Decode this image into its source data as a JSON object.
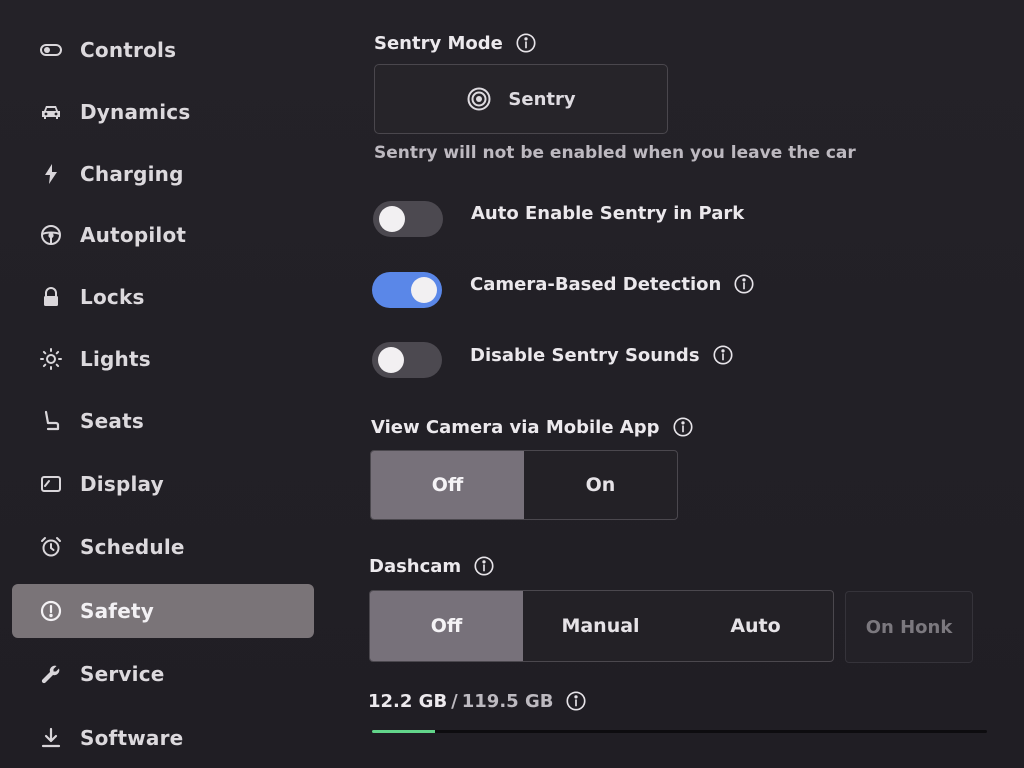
{
  "sidebar": {
    "items": [
      {
        "label": "Controls",
        "icon": "toggle-icon"
      },
      {
        "label": "Dynamics",
        "icon": "car-icon"
      },
      {
        "label": "Charging",
        "icon": "lightning-icon"
      },
      {
        "label": "Autopilot",
        "icon": "steering-wheel-icon"
      },
      {
        "label": "Locks",
        "icon": "lock-icon"
      },
      {
        "label": "Lights",
        "icon": "sun-icon"
      },
      {
        "label": "Seats",
        "icon": "seat-icon"
      },
      {
        "label": "Display",
        "icon": "display-icon"
      },
      {
        "label": "Schedule",
        "icon": "alarm-clock-icon"
      },
      {
        "label": "Safety",
        "icon": "alert-circle-icon"
      },
      {
        "label": "Service",
        "icon": "wrench-icon"
      },
      {
        "label": "Software",
        "icon": "download-icon"
      }
    ],
    "active": "Safety"
  },
  "sentry": {
    "heading": "Sentry Mode",
    "button_label": "Sentry",
    "button_icon": "sentry-target-icon",
    "note": "Sentry will not be enabled when you leave the car"
  },
  "toggles": [
    {
      "label": "Auto Enable Sentry in Park",
      "state": "off",
      "has_info": false
    },
    {
      "label": "Camera-Based Detection",
      "state": "on",
      "has_info": true
    },
    {
      "label": "Disable Sentry Sounds",
      "state": "off",
      "has_info": true
    }
  ],
  "view_camera": {
    "heading": "View Camera via Mobile App",
    "options": [
      "Off",
      "On"
    ],
    "selected": "Off"
  },
  "dashcam": {
    "heading": "Dashcam",
    "options": [
      "Off",
      "Manual",
      "Auto"
    ],
    "selected": "Off",
    "extra_option": "On Honk"
  },
  "storage": {
    "used": "12.2 GB",
    "separator": "/",
    "total": "119.5 GB",
    "fraction_used": 0.102
  },
  "colors": {
    "accent_toggle_on": "#5a87e8",
    "progress_fill": "#62d58a",
    "selected_segment": "#77717a"
  }
}
